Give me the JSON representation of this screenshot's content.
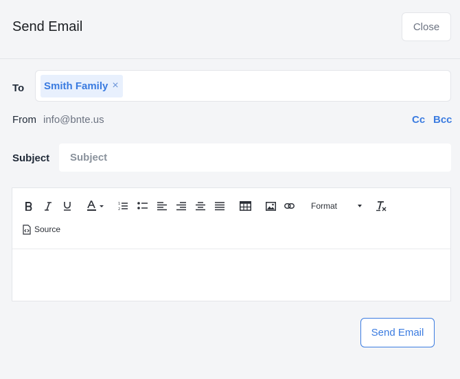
{
  "header": {
    "title": "Send Email",
    "close_label": "Close"
  },
  "to": {
    "label": "To",
    "recipients": [
      {
        "name": "Smith Family",
        "remove_icon": "close-icon"
      }
    ]
  },
  "from": {
    "label": "From",
    "value": "info@bnte.us"
  },
  "cc_label": "Cc",
  "bcc_label": "Bcc",
  "subject": {
    "label": "Subject",
    "placeholder": "Subject",
    "value": ""
  },
  "editor": {
    "toolbar": {
      "buttons": [
        "bold",
        "italic",
        "underline",
        "text-color",
        "numbered-list",
        "bulleted-list",
        "align-left",
        "align-right",
        "align-center",
        "justify",
        "table",
        "image",
        "link",
        "remove-format"
      ],
      "format_label": "Format",
      "source_label": "Source"
    },
    "body": ""
  },
  "send_label": "Send Email",
  "colors": {
    "accent": "#3a7be0",
    "chip_bg": "#e8f0fd",
    "page_bg": "#f4f5f7"
  }
}
